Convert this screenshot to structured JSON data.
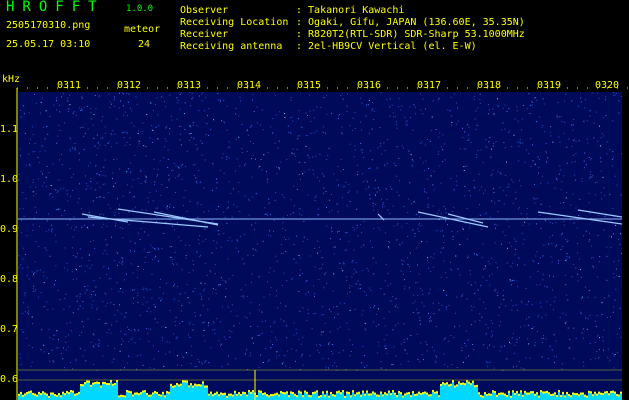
{
  "header": {
    "app_title": "HROFFT",
    "version": "1.0.0",
    "filename": "2505170310.png",
    "meteor_label": "meteor",
    "timestamp": "25.05.17 03:10",
    "meteor_count": "24"
  },
  "info": [
    {
      "key": "Observer",
      "value": ": Takanori Kawachi"
    },
    {
      "key": "Receiving Location",
      "value": ": Ogaki, Gifu, JAPAN (136.60E, 35.35N)"
    },
    {
      "key": "Receiver",
      "value": ": R820T2(RTL-SDR) SDR-Sharp 53.1000MHz"
    },
    {
      "key": "Receiving antenna",
      "value": ": 2el-HB9CV Vertical (el. E-W)"
    }
  ],
  "axes": {
    "y_unit": "kHz",
    "x_ticks": [
      "0311",
      "0312",
      "0313",
      "0314",
      "0315",
      "0316",
      "0317",
      "0318",
      "0319",
      "0320"
    ],
    "y_ticks": [
      "1.1",
      "1.0",
      "0.9",
      "0.8",
      "0.7",
      "0.6"
    ]
  },
  "colors": {
    "label_yellow": "#ffff00",
    "label_green": "#00ff00",
    "spectrogram_bg": "#000a5a",
    "carrier": "#8ab4ff",
    "activity_fill": "#00d8ff",
    "activity_peak": "#ffff00"
  }
}
